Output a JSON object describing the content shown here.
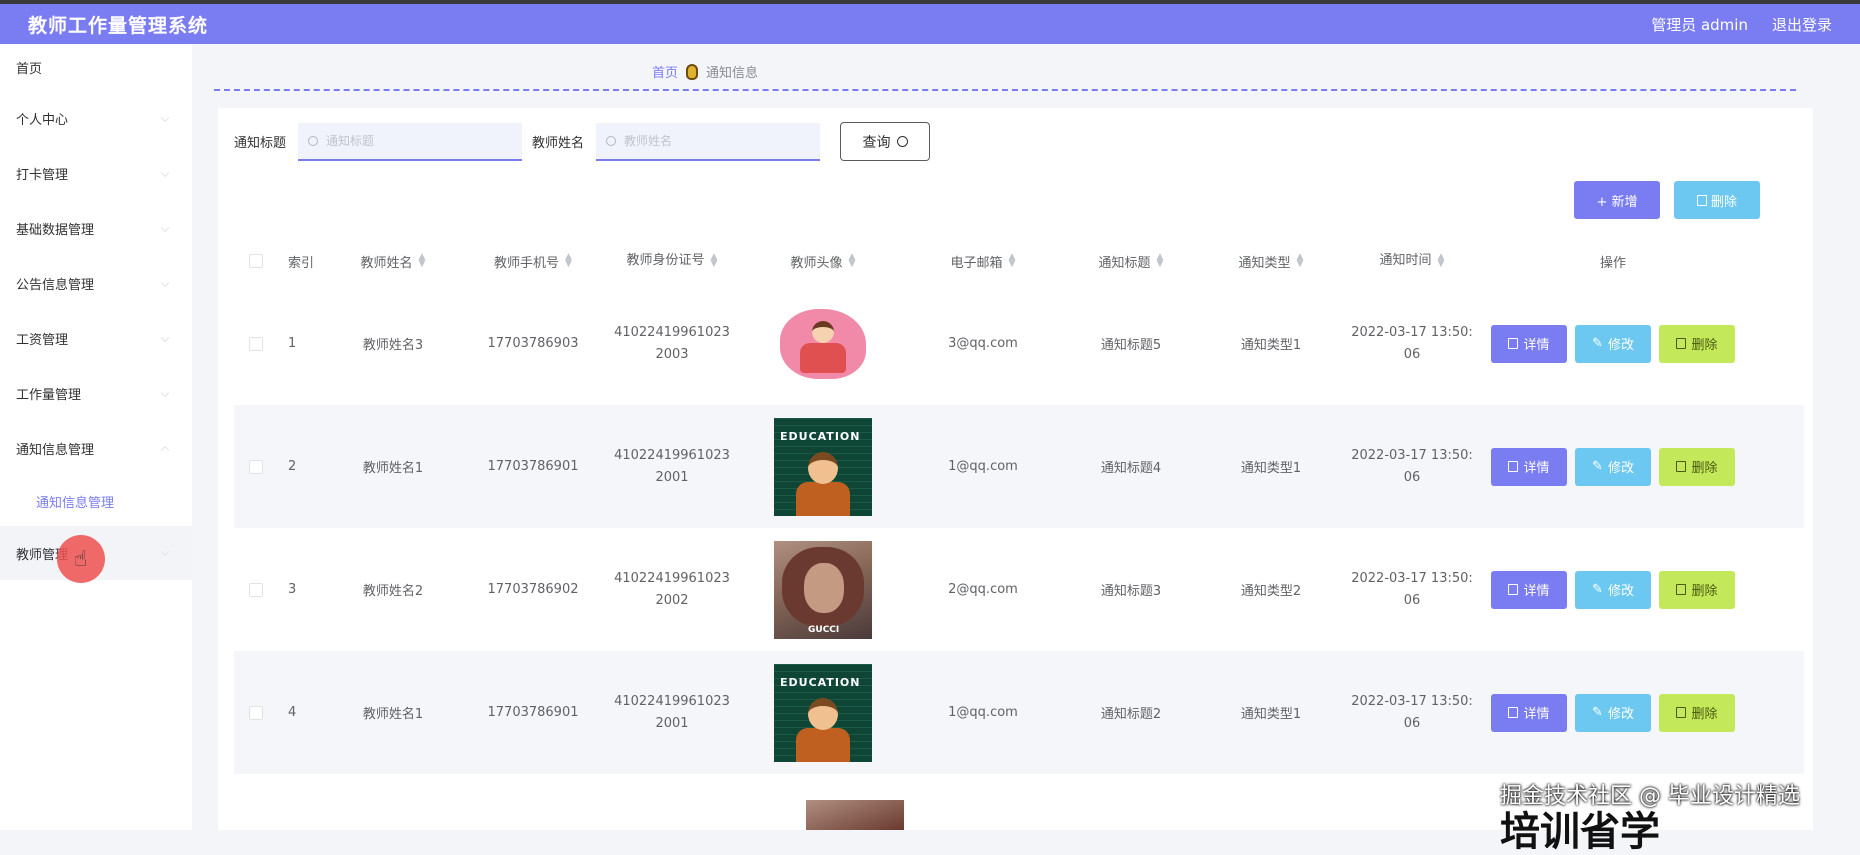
{
  "app": {
    "title": "教师工作量管理系统"
  },
  "topbar": {
    "user_label": "管理员 admin",
    "logout_label": "退出登录"
  },
  "sidebar": {
    "items": [
      {
        "label": "首页"
      },
      {
        "label": "个人中心"
      },
      {
        "label": "打卡管理"
      },
      {
        "label": "基础数据管理"
      },
      {
        "label": "公告信息管理"
      },
      {
        "label": "工资管理"
      },
      {
        "label": "工作量管理"
      },
      {
        "label": "通知信息管理"
      },
      {
        "label": "通知信息管理"
      },
      {
        "label": "教师管理"
      }
    ]
  },
  "breadcrumb": {
    "home": "首页",
    "current": "通知信息"
  },
  "search": {
    "title_label": "通知标题",
    "title_placeholder": "通知标题",
    "teacher_label": "教师姓名",
    "teacher_placeholder": "教师姓名",
    "query_label": "查询"
  },
  "actions": {
    "add_label": "+ 新增",
    "delete_label": "删除"
  },
  "table": {
    "headers": {
      "index": "索引",
      "name": "教师姓名",
      "phone": "教师手机号",
      "idcard": "教师身份证号",
      "avatar": "教师头像",
      "email": "电子邮箱",
      "title": "通知标题",
      "type": "通知类型",
      "time": "通知时间",
      "ops": "操作"
    },
    "op_labels": {
      "detail": "详情",
      "edit": "修改",
      "delete": "删除"
    },
    "rows": [
      {
        "index": "1",
        "name": "教师姓名3",
        "phone": "17703786903",
        "idcard_line1": "41022419961023",
        "idcard_line2": "2003",
        "avatar": "cartoon",
        "email": "3@qq.com",
        "title": "通知标题5",
        "type": "通知类型1",
        "time_line1": "2022-03-17 13:50:",
        "time_line2": "06"
      },
      {
        "index": "2",
        "name": "教师姓名1",
        "phone": "17703786901",
        "idcard_line1": "41022419961023",
        "idcard_line2": "2001",
        "avatar": "education",
        "email": "1@qq.com",
        "title": "通知标题4",
        "type": "通知类型1",
        "time_line1": "2022-03-17 13:50:",
        "time_line2": "06"
      },
      {
        "index": "3",
        "name": "教师姓名2",
        "phone": "17703786902",
        "idcard_line1": "41022419961023",
        "idcard_line2": "2002",
        "avatar": "photo",
        "email": "2@qq.com",
        "title": "通知标题3",
        "type": "通知类型2",
        "time_line1": "2022-03-17 13:50:",
        "time_line2": "06"
      },
      {
        "index": "4",
        "name": "教师姓名1",
        "phone": "17703786901",
        "idcard_line1": "41022419961023",
        "idcard_line2": "2001",
        "avatar": "education",
        "email": "1@qq.com",
        "title": "通知标题2",
        "type": "通知类型1",
        "time_line1": "2022-03-17 13:50:",
        "time_line2": "06"
      }
    ]
  },
  "avatar_text": {
    "education": "EDUCATION",
    "photo": "GUCCI"
  },
  "overlay": {
    "watermark": "掘金技术社区 @ 毕业设计精选",
    "bottom_text": "培训省学"
  },
  "colors": {
    "primary": "#7a7cf2",
    "info": "#6cc8f0",
    "lime": "#c3e85a"
  }
}
